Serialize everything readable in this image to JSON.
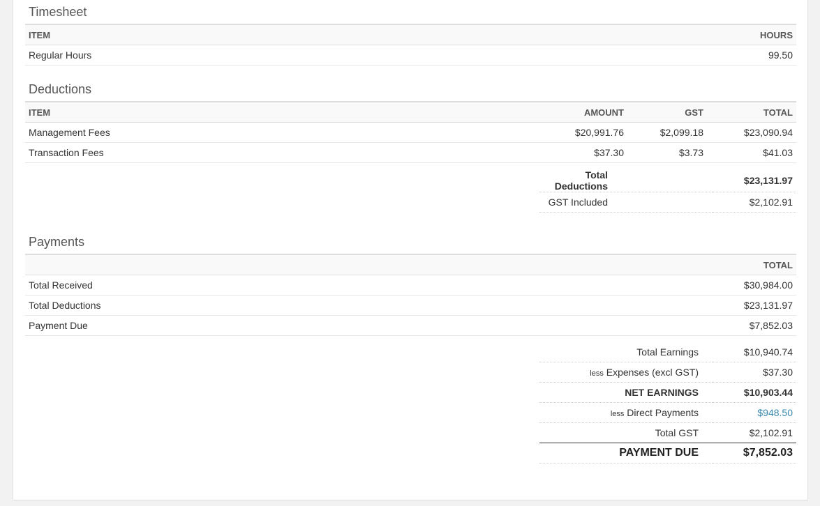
{
  "timesheet": {
    "title": "Timesheet",
    "headers": {
      "item": "ITEM",
      "hours": "HOURS"
    },
    "rows": [
      {
        "item": "Regular Hours",
        "hours": "99.50"
      }
    ]
  },
  "deductions": {
    "title": "Deductions",
    "headers": {
      "item": "ITEM",
      "amount": "AMOUNT",
      "gst": "GST",
      "total": "TOTAL"
    },
    "rows": [
      {
        "item": "Management Fees",
        "amount": "$20,991.76",
        "gst": "$2,099.18",
        "total": "$23,090.94"
      },
      {
        "item": "Transaction Fees",
        "amount": "$37.30",
        "gst": "$3.73",
        "total": "$41.03"
      }
    ],
    "summary": {
      "total_label": "Total Deductions",
      "total_value": "$23,131.97",
      "gst_label": "GST Included",
      "gst_value": "$2,102.91"
    }
  },
  "payments": {
    "title": "Payments",
    "headers": {
      "total": "TOTAL"
    },
    "rows": [
      {
        "item": "Total Received",
        "total": "$30,984.00"
      },
      {
        "item": "Total Deductions",
        "total": "$23,131.97"
      },
      {
        "item": "Payment Due",
        "total": "$7,852.03"
      }
    ],
    "summary": {
      "earnings_label": "Total Earnings",
      "earnings_value": "$10,940.74",
      "less_word": "less",
      "expenses_label": "Expenses (excl GST)",
      "expenses_value": "$37.30",
      "net_label": "NET EARNINGS",
      "net_value": "$10,903.44",
      "direct_label": "Direct Payments",
      "direct_value": "$948.50",
      "gst_label": "Total GST",
      "gst_value": "$2,102.91",
      "due_label": "PAYMENT DUE",
      "due_value": "$7,852.03"
    }
  },
  "colors": {
    "link": "#3a87ad",
    "header_bg": "#f9f9f9"
  }
}
